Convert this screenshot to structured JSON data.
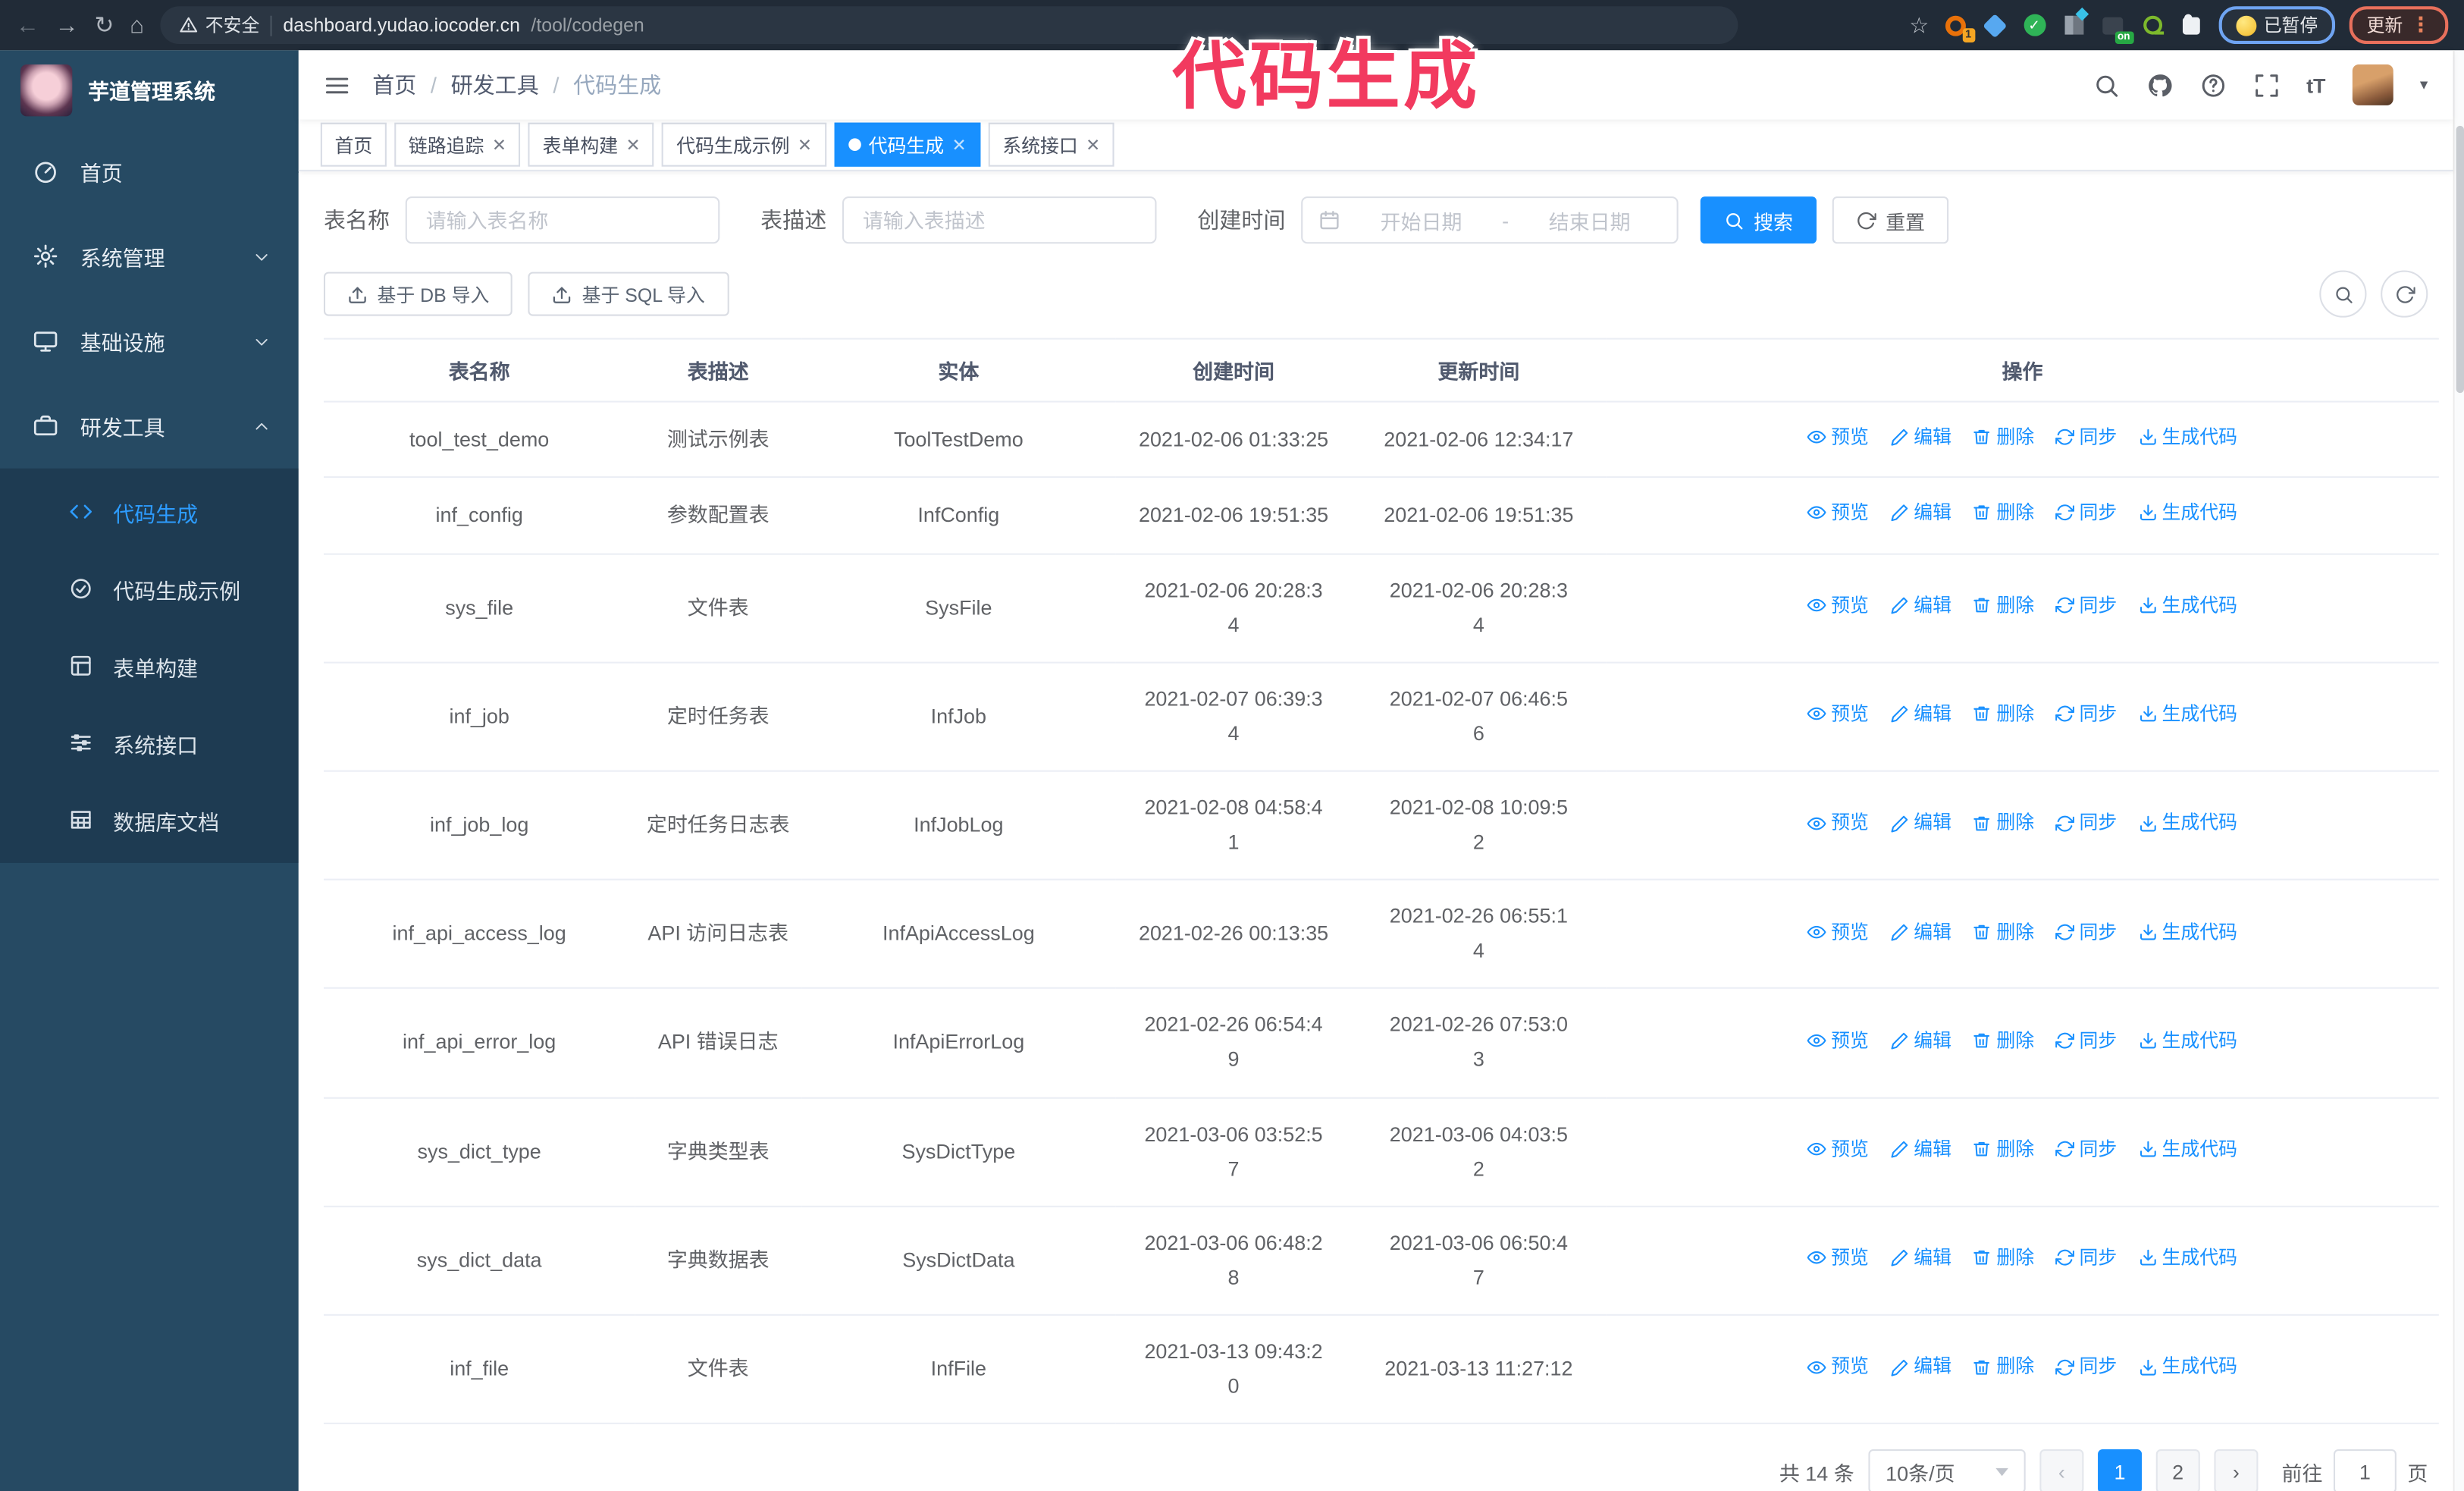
{
  "browser": {
    "security_label": "不安全",
    "url_host": "dashboard.yudao.iocoder.cn",
    "url_path": "/tool/codegen",
    "extension_badge": "1",
    "extension_on_badge": "on",
    "paused_label": "已暂停",
    "update_label": "更新",
    "icons": [
      "back-icon",
      "forward-icon",
      "reload-icon",
      "home-icon",
      "warning-icon",
      "star-icon",
      "extension-orange-icon",
      "extension-gem-icon",
      "extension-green-check-icon",
      "extension-columns-icon",
      "extension-on-icon",
      "extension-key-icon",
      "extension-puzzle-icon",
      "menu-dots-icon"
    ]
  },
  "annotation": {
    "title": "代码生成",
    "color": "#f23a5f"
  },
  "sidebar": {
    "app_title": "芋道管理系统",
    "items": [
      {
        "label": "首页",
        "icon": "dashboard-icon",
        "chevron": null
      },
      {
        "label": "系统管理",
        "icon": "gear-icon",
        "chevron": "down"
      },
      {
        "label": "基础设施",
        "icon": "monitor-icon",
        "chevron": "down"
      },
      {
        "label": "研发工具",
        "icon": "toolbox-icon",
        "chevron": "up"
      }
    ],
    "subitems": [
      {
        "label": "代码生成",
        "icon": "code-icon",
        "active": true
      },
      {
        "label": "代码生成示例",
        "icon": "example-check-icon",
        "active": false
      },
      {
        "label": "表单构建",
        "icon": "form-icon",
        "active": false
      },
      {
        "label": "系统接口",
        "icon": "api-lines-icon",
        "active": false
      },
      {
        "label": "数据库文档",
        "icon": "database-table-icon",
        "active": false
      }
    ]
  },
  "header": {
    "breadcrumb": [
      "首页",
      "研发工具",
      "代码生成"
    ],
    "icons": [
      "search-icon",
      "github-icon",
      "help-icon",
      "fullscreen-icon",
      "font-size-icon",
      "avatar",
      "chevron-down-icon"
    ]
  },
  "tabs": [
    {
      "label": "首页",
      "closable": false,
      "active": false
    },
    {
      "label": "链路追踪",
      "closable": true,
      "active": false
    },
    {
      "label": "表单构建",
      "closable": true,
      "active": false
    },
    {
      "label": "代码生成示例",
      "closable": true,
      "active": false
    },
    {
      "label": "代码生成",
      "closable": true,
      "active": true
    },
    {
      "label": "系统接口",
      "closable": true,
      "active": false
    }
  ],
  "filters": {
    "table_name_label": "表名称",
    "table_name_placeholder": "请输入表名称",
    "table_desc_label": "表描述",
    "table_desc_placeholder": "请输入表描述",
    "create_time_label": "创建时间",
    "date_start_placeholder": "开始日期",
    "date_separator": "-",
    "date_end_placeholder": "结束日期",
    "search_label": "搜索",
    "reset_label": "重置"
  },
  "toolbar": {
    "import_db_label": "基于 DB 导入",
    "import_sql_label": "基于 SQL 导入"
  },
  "table": {
    "columns": [
      "表名称",
      "表描述",
      "实体",
      "创建时间",
      "更新时间",
      "操作"
    ],
    "actions": [
      "预览",
      "编辑",
      "删除",
      "同步",
      "生成代码"
    ],
    "action_icons": [
      "eye-icon",
      "edit-icon",
      "delete-icon",
      "sync-icon",
      "download-icon"
    ],
    "rows": [
      {
        "name": "tool_test_demo",
        "desc": "测试示例表",
        "entity": "ToolTestDemo",
        "create_time": "2021-02-06 01:33:25",
        "update_time": "2021-02-06 12:34:17",
        "create_wrap": false,
        "update_wrap": false
      },
      {
        "name": "inf_config",
        "desc": "参数配置表",
        "entity": "InfConfig",
        "create_time": "2021-02-06 19:51:35",
        "update_time": "2021-02-06 19:51:35",
        "create_wrap": false,
        "update_wrap": false
      },
      {
        "name": "sys_file",
        "desc": "文件表",
        "entity": "SysFile",
        "create_time": "2021-02-06 20:28:34",
        "update_time": "2021-02-06 20:28:34",
        "create_wrap": true,
        "update_wrap": true
      },
      {
        "name": "inf_job",
        "desc": "定时任务表",
        "entity": "InfJob",
        "create_time": "2021-02-07 06:39:34",
        "update_time": "2021-02-07 06:46:56",
        "create_wrap": true,
        "update_wrap": true
      },
      {
        "name": "inf_job_log",
        "desc": "定时任务日志表",
        "entity": "InfJobLog",
        "create_time": "2021-02-08 04:58:41",
        "update_time": "2021-02-08 10:09:52",
        "create_wrap": true,
        "update_wrap": true
      },
      {
        "name": "inf_api_access_log",
        "desc": "API 访问日志表",
        "entity": "InfApiAccessLog",
        "create_time": "2021-02-26 00:13:35",
        "update_time": "2021-02-26 06:55:14",
        "create_wrap": false,
        "update_wrap": true
      },
      {
        "name": "inf_api_error_log",
        "desc": "API 错误日志",
        "entity": "InfApiErrorLog",
        "create_time": "2021-02-26 06:54:49",
        "update_time": "2021-02-26 07:53:03",
        "create_wrap": true,
        "update_wrap": true
      },
      {
        "name": "sys_dict_type",
        "desc": "字典类型表",
        "entity": "SysDictType",
        "create_time": "2021-03-06 03:52:57",
        "update_time": "2021-03-06 04:03:52",
        "create_wrap": true,
        "update_wrap": true
      },
      {
        "name": "sys_dict_data",
        "desc": "字典数据表",
        "entity": "SysDictData",
        "create_time": "2021-03-06 06:48:28",
        "update_time": "2021-03-06 06:50:47",
        "create_wrap": true,
        "update_wrap": true
      },
      {
        "name": "inf_file",
        "desc": "文件表",
        "entity": "InfFile",
        "create_time": "2021-03-13 09:43:20",
        "update_time": "2021-03-13 11:27:12",
        "create_wrap": true,
        "update_wrap": false
      }
    ]
  },
  "pagination": {
    "total_label": "共 14 条",
    "page_size_label": "10条/页",
    "pages": [
      {
        "label": "1",
        "active": true
      },
      {
        "label": "2",
        "active": false
      }
    ],
    "goto_label": "前往",
    "goto_value": "1",
    "goto_suffix": "页"
  },
  "colors": {
    "primary": "#1890ff",
    "sidebar_bg": "#264a63",
    "submenu_bg": "#1e3b52",
    "annotation": "#f23a5f"
  }
}
